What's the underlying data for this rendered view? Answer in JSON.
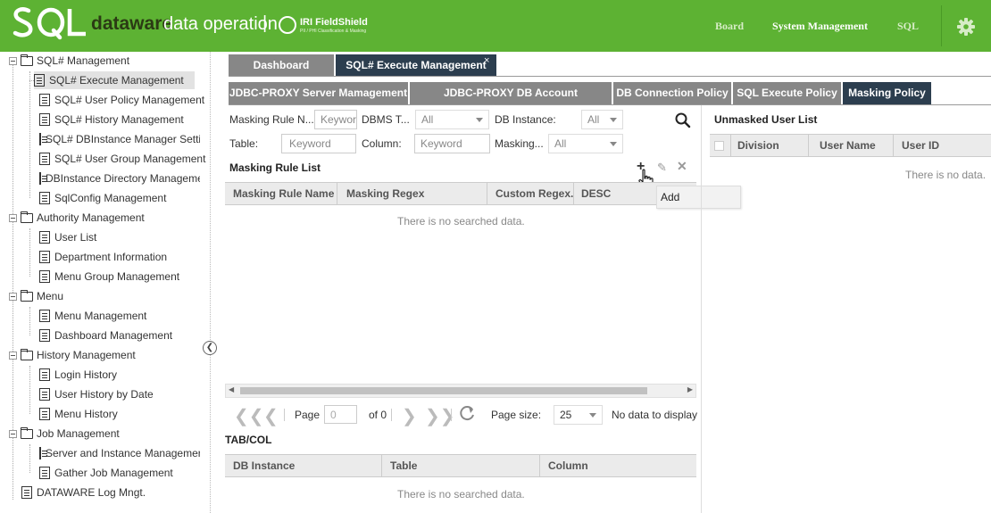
{
  "header": {
    "brand_bold": "dataware",
    "brand_rest": "data operation",
    "separator": "|",
    "partner": "IRI FieldShield",
    "partner_sub": "PII / PHI Classification & Masking",
    "nav": [
      "Board",
      "System Management",
      "SQL"
    ],
    "colors": {
      "bar": "#5db233",
      "active_tab": "#2c3e4f",
      "inactive_tab": "#878787"
    }
  },
  "sidebar": {
    "items": [
      {
        "label": "SQL# Management",
        "type": "folder"
      },
      {
        "label": "SQL# Execute Management",
        "type": "doc",
        "selected": true
      },
      {
        "label": "SQL# User Policy Management",
        "type": "doc"
      },
      {
        "label": "SQL# History Management",
        "type": "doc"
      },
      {
        "label": "SQL# DBInstance Manager Setti",
        "type": "doc"
      },
      {
        "label": "SQL# User Group Management",
        "type": "doc"
      },
      {
        "label": "DBInstance Directory Manageme",
        "type": "doc"
      },
      {
        "label": "SqlConfig Management",
        "type": "doc"
      },
      {
        "label": "Authority Management",
        "type": "folder"
      },
      {
        "label": "User List",
        "type": "doc"
      },
      {
        "label": "Department Information",
        "type": "doc"
      },
      {
        "label": "Menu Group Management",
        "type": "doc"
      },
      {
        "label": "Menu",
        "type": "folder"
      },
      {
        "label": "Menu Management",
        "type": "doc"
      },
      {
        "label": "Dashboard Management",
        "type": "doc"
      },
      {
        "label": "History Management",
        "type": "folder"
      },
      {
        "label": "Login History",
        "type": "doc"
      },
      {
        "label": "User History by Date",
        "type": "doc"
      },
      {
        "label": "Menu History",
        "type": "doc"
      },
      {
        "label": "Job Management",
        "type": "folder"
      },
      {
        "label": "Server and Instance Managemer",
        "type": "doc"
      },
      {
        "label": "Gather Job Management",
        "type": "doc"
      },
      {
        "label": "DATAWARE Log Mngt.",
        "type": "doc"
      }
    ]
  },
  "tabs": {
    "dashboard": "Dashboard",
    "sql_exec": "SQL# Execute Management",
    "close": "×"
  },
  "subtabs": [
    "JDBC-PROXY Server Mamagement",
    "JDBC-PROXY DB Account Management",
    "DB Connection Policy",
    "SQL Execute Policy",
    "Masking Policy"
  ],
  "filters": {
    "masking_rule_name_label": "Masking Rule N...",
    "masking_rule_name_placeholder": "Keywor",
    "dbms_type_label": "DBMS T...",
    "dbms_type_value": "All",
    "db_instance_label": "DB Instance:",
    "db_instance_value": "All",
    "table_label": "Table:",
    "table_placeholder": "Keyword",
    "column_label": "Column:",
    "column_placeholder": "Keyword",
    "masking_label": "Masking...",
    "masking_value": "All"
  },
  "masking_rule_list": {
    "title": "Masking Rule List",
    "actions": {
      "add": "+",
      "edit": "✎",
      "delete": "✕"
    },
    "tooltip": "Add",
    "columns": [
      "Masking Rule Name",
      "Masking Regex",
      "Custom Regex...",
      "DESC"
    ],
    "empty": "There is no searched data."
  },
  "pager": {
    "page_label": "Page",
    "page_value": "0",
    "of_label": "of 0",
    "page_size_label": "Page size:",
    "page_size_value": "25",
    "status": "No data to display"
  },
  "tabcol": {
    "title": "TAB/COL",
    "columns": [
      "DB Instance",
      "Table",
      "Column"
    ],
    "empty": "There is no searched data."
  },
  "unmasked": {
    "title": "Unmasked User List",
    "columns": [
      "Division",
      "User Name",
      "User ID"
    ],
    "empty": "There is no data."
  }
}
